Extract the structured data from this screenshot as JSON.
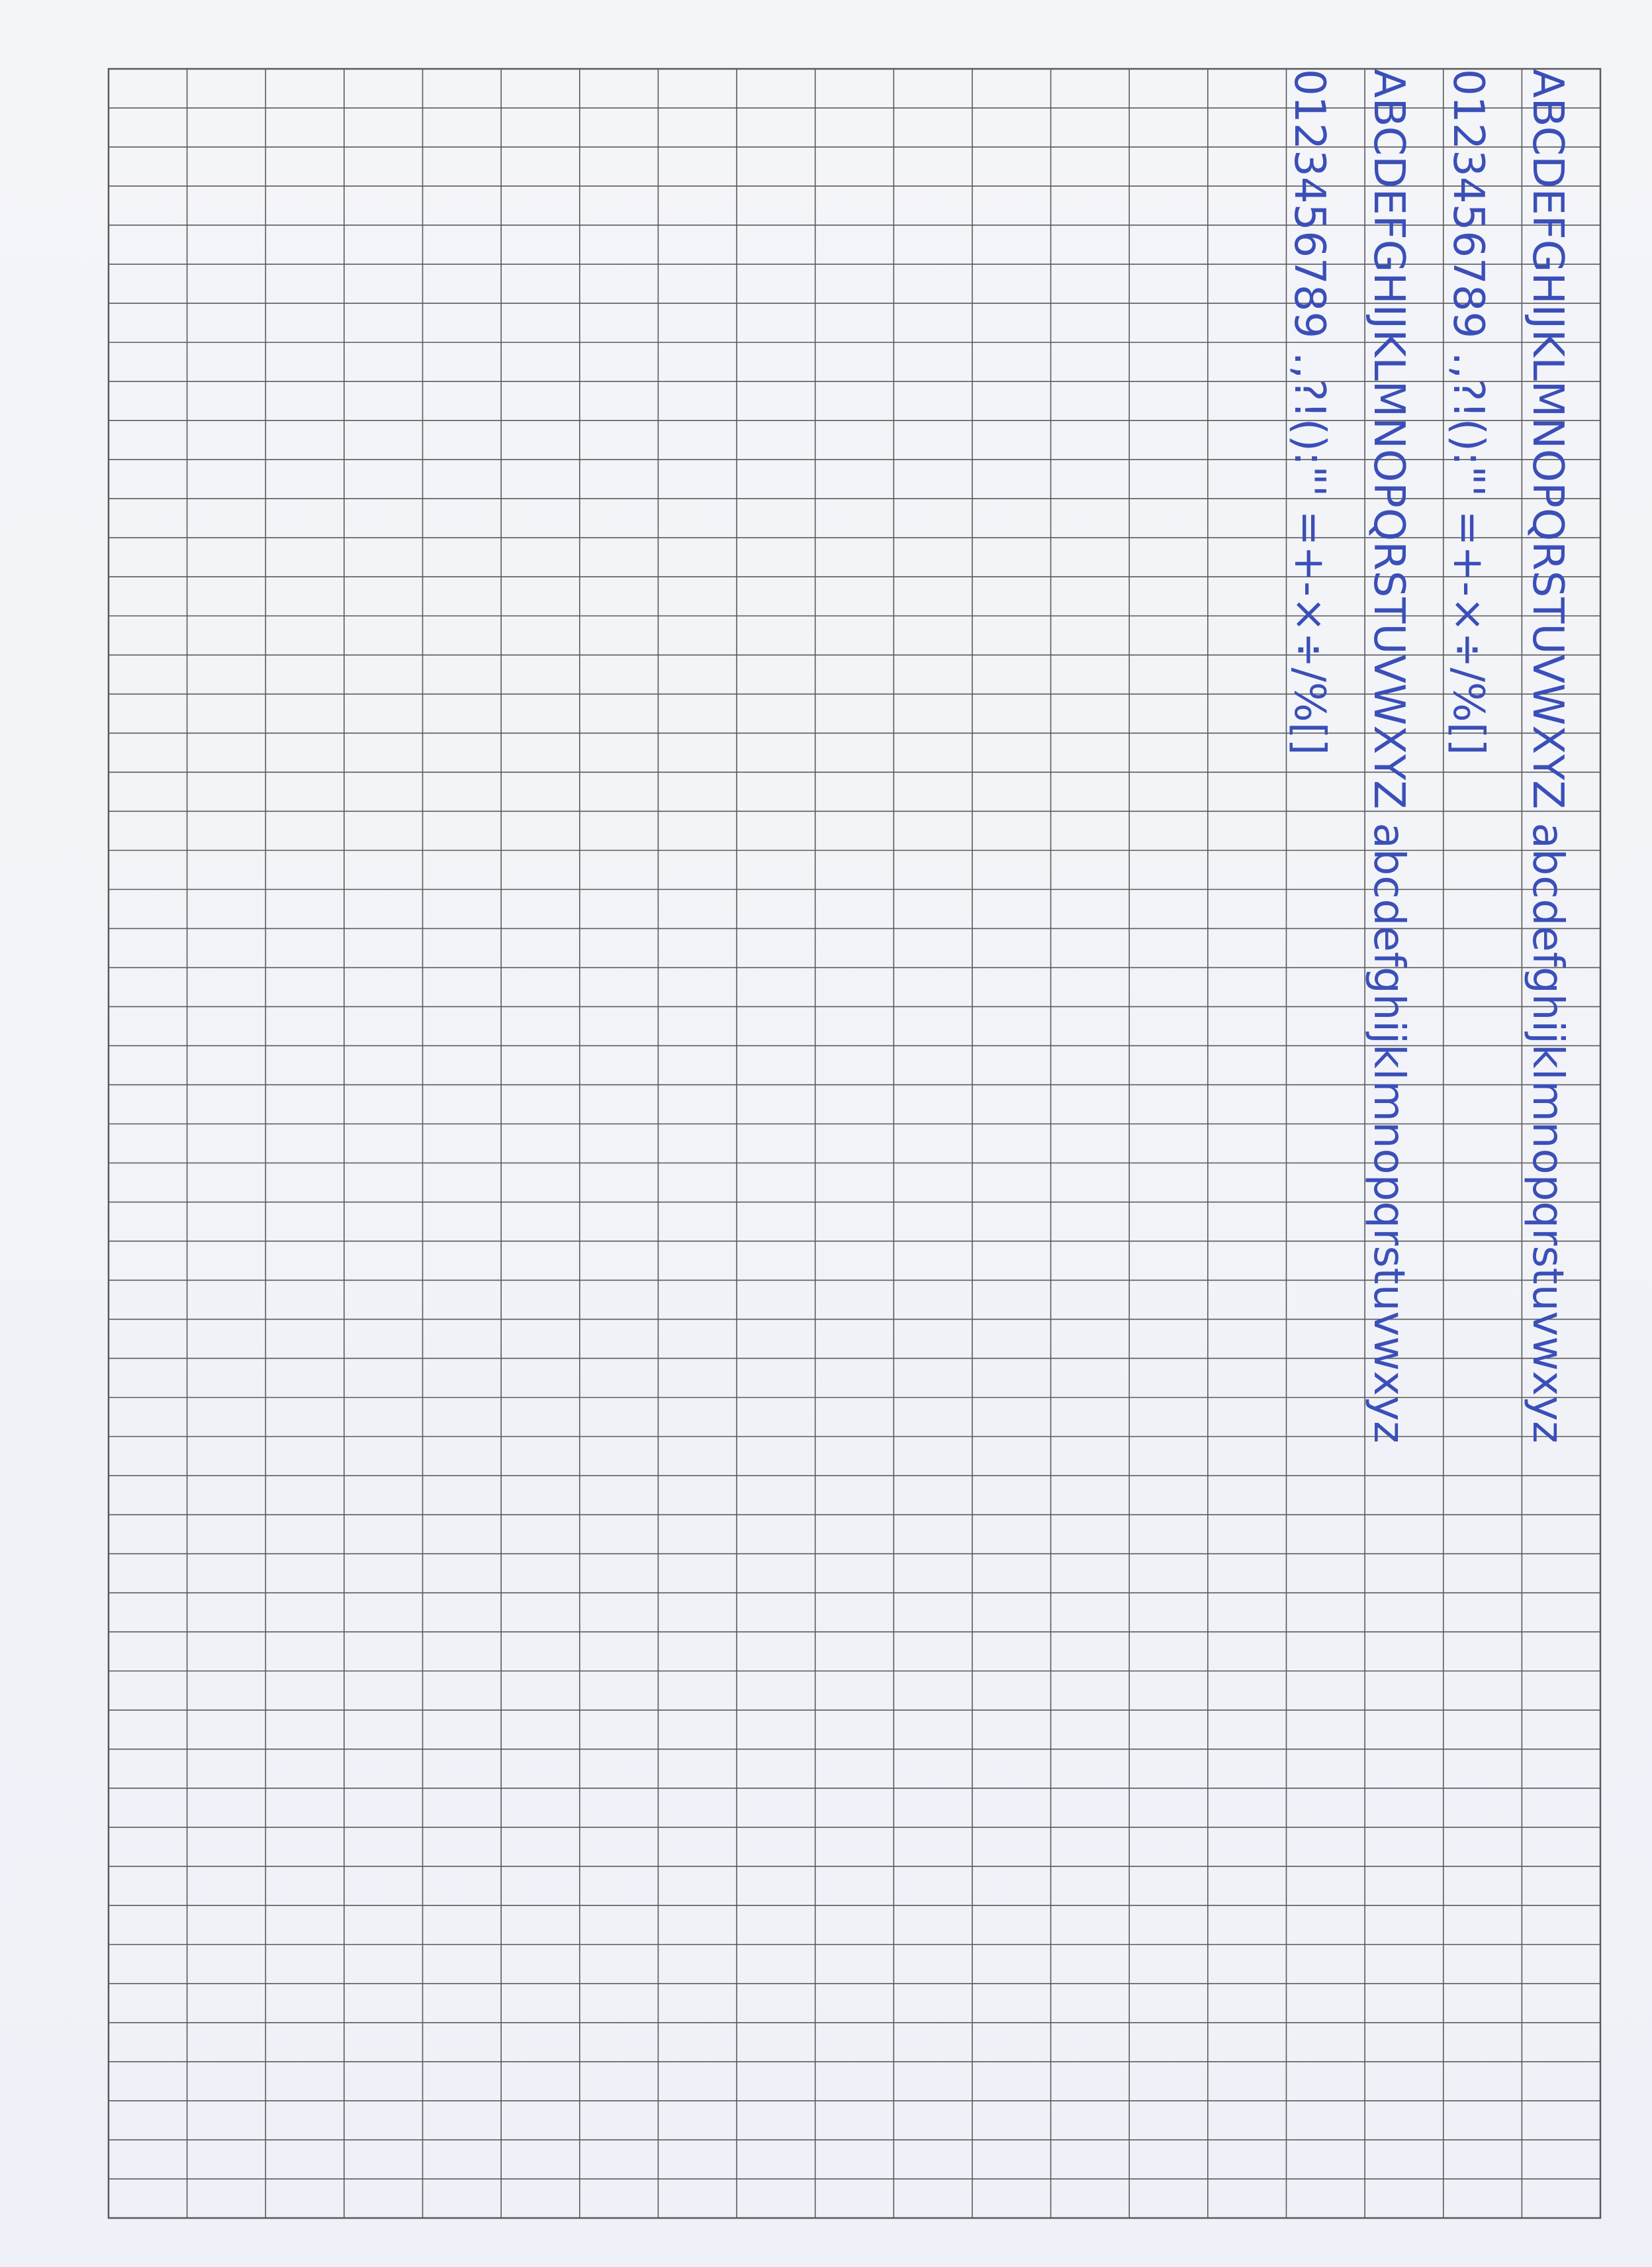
{
  "handwriting": {
    "rows": [
      "ABCDEFGHIJKLMNOPQRSTUVWXYZ abcdefghijklmnopqrstuvwxyz",
      "0123456789 .,?!():\"' =+-×÷/%[]",
      "ABCDEFGHIJKLMNOPQRSTUVWXYZ abcdefghijklmnopqrstuvwxyz",
      "0123456789 .,?!():\"' =+-×÷/%[]"
    ],
    "ink_color": "#3b4fb8"
  },
  "grid": {
    "columns": 19,
    "rows": 55,
    "line_color": "#5a5a5a"
  }
}
